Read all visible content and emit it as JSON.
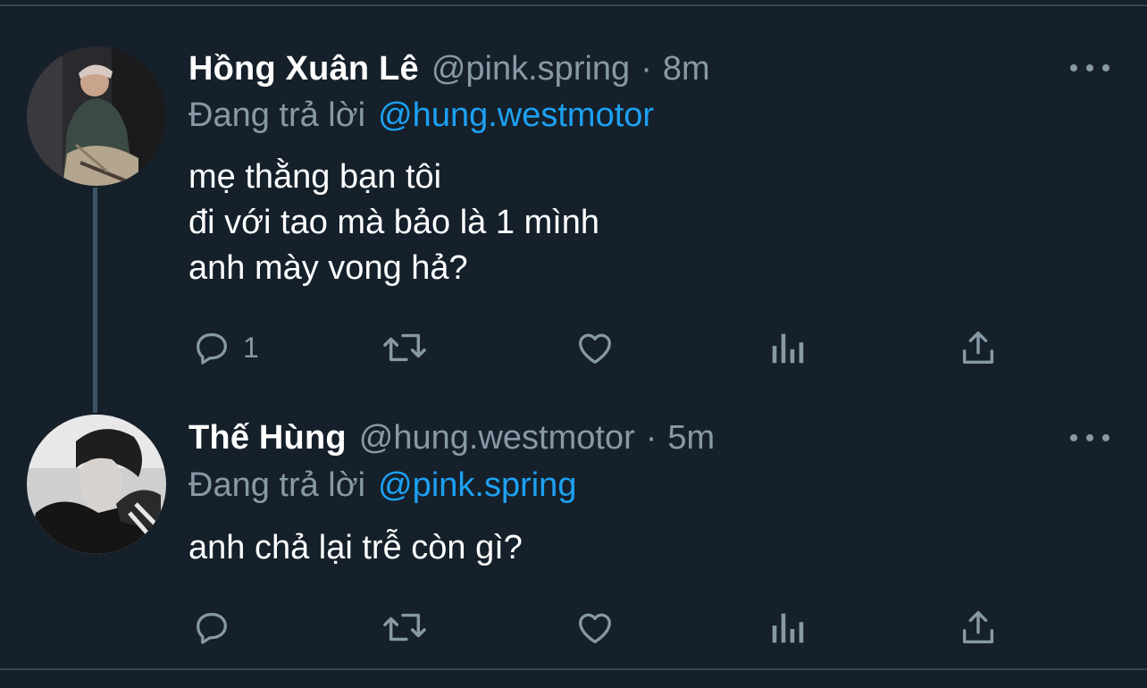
{
  "tweets": [
    {
      "display_name": "Hồng Xuân Lê",
      "handle": "@pink.spring",
      "separator": "·",
      "time": "8m",
      "reply_label": "Đang trả lời",
      "reply_to": "@hung.westmotor",
      "body_lines": [
        "mẹ thằng bạn tôi",
        "đi với tao mà bảo là 1 mình",
        "anh mày vong hả?"
      ],
      "reply_count": "1"
    },
    {
      "display_name": "Thế Hùng",
      "handle": "@hung.westmotor",
      "separator": "·",
      "time": "5m",
      "reply_label": "Đang trả lời",
      "reply_to": "@pink.spring",
      "body_lines": [
        "anh chả lại trễ còn gì?"
      ],
      "reply_count": ""
    }
  ],
  "colors": {
    "background": "#15202b",
    "secondary_text": "#8899a6",
    "link": "#1da1f2",
    "thread_line": "#3d5466"
  },
  "icons": [
    "reply-icon",
    "retweet-icon",
    "like-icon",
    "analytics-icon",
    "share-icon",
    "more-icon"
  ]
}
